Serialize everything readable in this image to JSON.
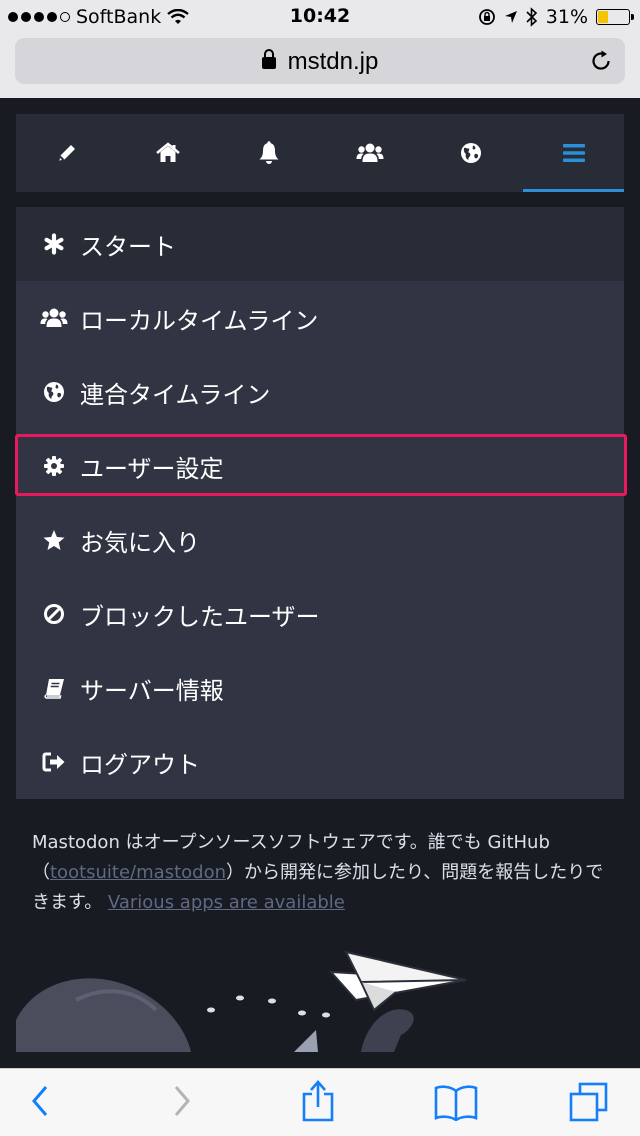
{
  "status_bar": {
    "carrier": "SoftBank",
    "time": "10:42",
    "battery_percent": "31%",
    "battery_level": 0.31,
    "icons": [
      "signal-dots-icon",
      "wifi-icon",
      "rotation-lock-icon",
      "location-icon",
      "bluetooth-icon",
      "battery-icon"
    ]
  },
  "browser": {
    "url": "mstdn.jp",
    "icons": [
      "lock-icon",
      "reload-icon"
    ]
  },
  "nav": {
    "items": [
      {
        "name": "compose",
        "icon": "pencil-icon"
      },
      {
        "name": "home",
        "icon": "home-icon"
      },
      {
        "name": "notifications",
        "icon": "bell-icon"
      },
      {
        "name": "local",
        "icon": "users-icon"
      },
      {
        "name": "federated",
        "icon": "globe-icon"
      },
      {
        "name": "menu",
        "icon": "bars-icon",
        "active": true
      }
    ],
    "accent": "#2b90d9"
  },
  "menu": {
    "items": [
      {
        "label": "スタート",
        "icon": "asterisk-icon"
      },
      {
        "label": "ローカルタイムライン",
        "icon": "users-icon"
      },
      {
        "label": "連合タイムライン",
        "icon": "globe-icon"
      },
      {
        "label": "ユーザー設定",
        "icon": "gear-icon",
        "highlighted": true
      },
      {
        "label": "お気に入り",
        "icon": "star-icon"
      },
      {
        "label": "ブロックしたユーザー",
        "icon": "ban-icon"
      },
      {
        "label": "サーバー情報",
        "icon": "book-icon"
      },
      {
        "label": "ログアウト",
        "icon": "sign-out-icon"
      }
    ],
    "highlight_color": "#e8195c"
  },
  "footer": {
    "text_before": "Mastodon はオープンソースソフトウェアです。誰でも GitHub（",
    "repo_link": "tootsuite/mastodon",
    "text_after": "）から開発に参加したり、問題を報告したりできます。 ",
    "apps_link": "Various apps are available"
  },
  "toolbar": {
    "icons": [
      "back-icon",
      "forward-icon",
      "share-icon",
      "bookmarks-icon",
      "tabs-icon"
    ]
  }
}
